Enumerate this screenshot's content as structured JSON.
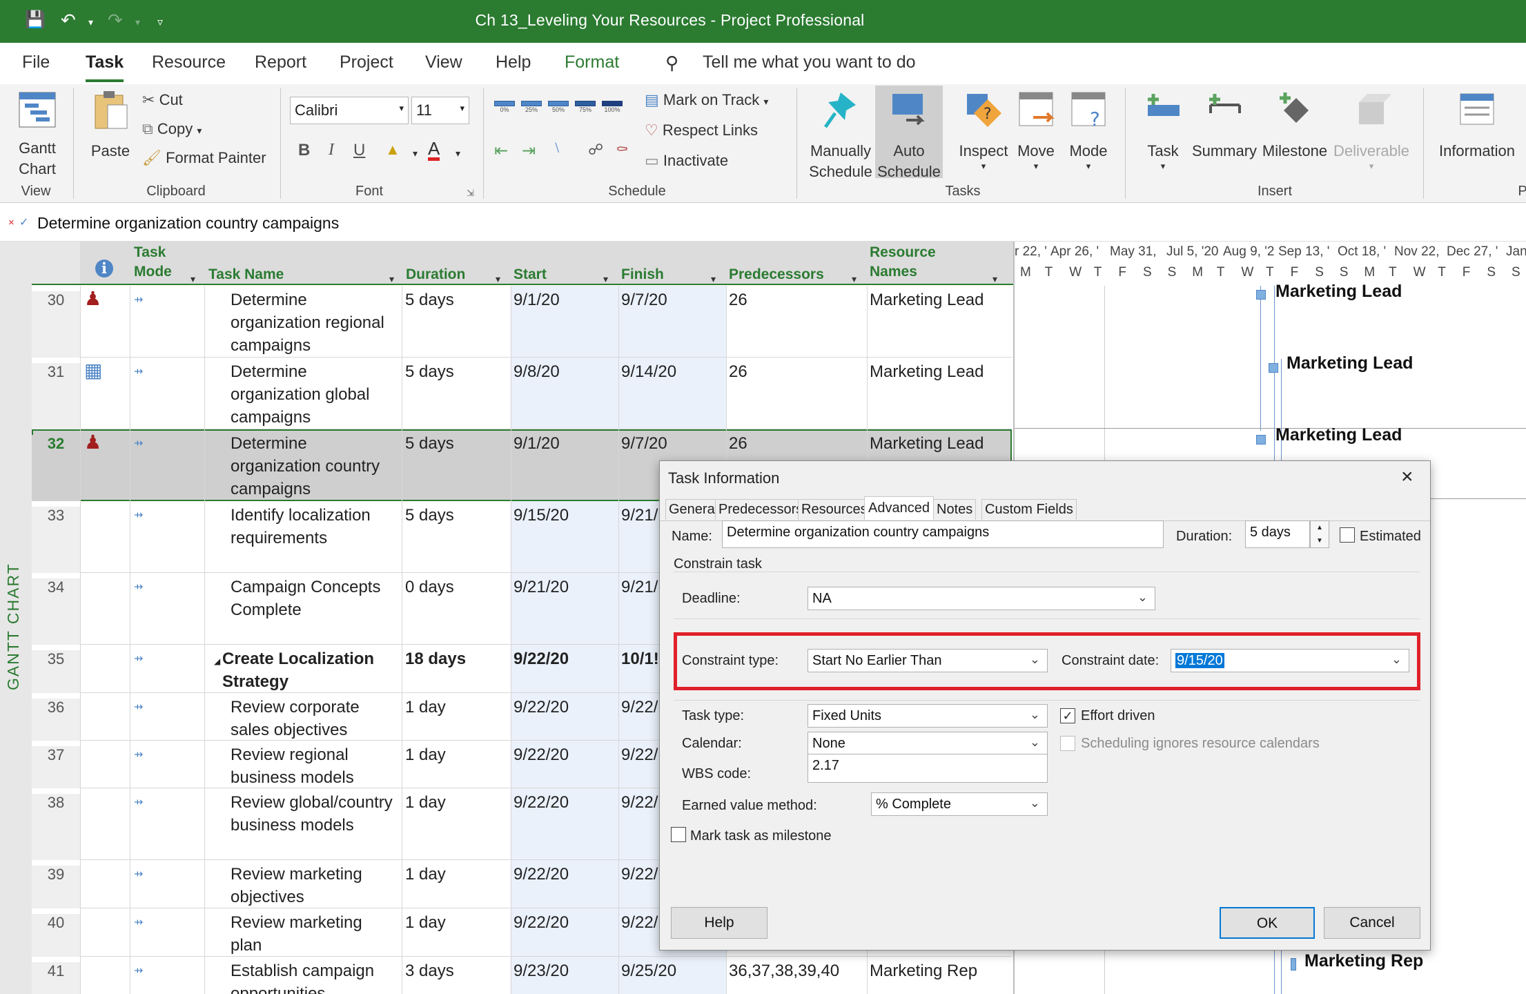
{
  "window": {
    "title": "Ch 13_Leveling Your Resources  -  Project Professional"
  },
  "tabs": [
    "File",
    "Task",
    "Resource",
    "Report",
    "Project",
    "View",
    "Help",
    "Format"
  ],
  "search": {
    "placeholder": "Tell me what you want to do"
  },
  "ribbon": {
    "view_group": {
      "gantt_label": "Gantt\nChart",
      "label": "View"
    },
    "clipboard": {
      "paste": "Paste",
      "cut": "Cut",
      "copy": "Copy",
      "format_painter": "Format Painter",
      "label": "Clipboard"
    },
    "font": {
      "family": "Calibri",
      "size": "11",
      "label": "Font"
    },
    "schedule": {
      "mark_on_track": "Mark on Track",
      "respect_links": "Respect Links",
      "inactivate": "Inactivate",
      "label": "Schedule",
      "pct": [
        "0%",
        "25%",
        "50%",
        "75%",
        "100%"
      ]
    },
    "tasks": {
      "manually": "Manually\nSchedule",
      "auto": "Auto\nSchedule",
      "inspect": "Inspect",
      "move": "Move",
      "mode": "Mode",
      "label": "Tasks"
    },
    "insert": {
      "task": "Task",
      "summary": "Summary",
      "milestone": "Milestone",
      "deliverable": "Deliverable",
      "label": "Insert"
    },
    "properties": {
      "information": "Information",
      "label": "P"
    }
  },
  "entry_bar": {
    "value": "Determine organization country campaigns"
  },
  "side_label": "GANTT CHART",
  "columns": {
    "task_mode": "Task\nMode",
    "task_name": "Task Name",
    "duration": "Duration",
    "start": "Start",
    "finish": "Finish",
    "predecessors": "Predecessors",
    "resource_names": "Resource\nNames"
  },
  "rows": [
    {
      "id": "30",
      "name": "Determine\norganization regional\ncampaigns",
      "duration": "5 days",
      "start": "9/1/20",
      "finish": "9/7/20",
      "pred": "26",
      "res": "Marketing Lead"
    },
    {
      "id": "31",
      "name": "Determine\norganization global\ncampaigns",
      "duration": "5 days",
      "start": "9/8/20",
      "finish": "9/14/20",
      "pred": "26",
      "res": "Marketing Lead"
    },
    {
      "id": "32",
      "name": "Determine\norganization country\ncampaigns",
      "duration": "5 days",
      "start": "9/1/20",
      "finish": "9/7/20",
      "pred": "26",
      "res": "Marketing Lead"
    },
    {
      "id": "33",
      "name": "Identify localization\nrequirements",
      "duration": "5 days",
      "start": "9/15/20",
      "finish": "9/21/",
      "pred": "",
      "res": ""
    },
    {
      "id": "34",
      "name": "Campaign Concepts\nComplete",
      "duration": "0 days",
      "start": "9/21/20",
      "finish": "9/21/",
      "pred": "",
      "res": ""
    },
    {
      "id": "35",
      "name": "Create Localization\nStrategy",
      "duration": "18 days",
      "start": "9/22/20",
      "finish": "10/1!",
      "pred": "",
      "res": ""
    },
    {
      "id": "36",
      "name": "Review corporate\nsales objectives",
      "duration": "1 day",
      "start": "9/22/20",
      "finish": "9/22/",
      "pred": "",
      "res": ""
    },
    {
      "id": "37",
      "name": "Review regional\nbusiness models",
      "duration": "1 day",
      "start": "9/22/20",
      "finish": "9/22/",
      "pred": "",
      "res": ""
    },
    {
      "id": "38",
      "name": "Review global/country\nbusiness models",
      "duration": "1 day",
      "start": "9/22/20",
      "finish": "9/22/",
      "pred": "",
      "res": ""
    },
    {
      "id": "39",
      "name": "Review marketing\nobjectives",
      "duration": "1 day",
      "start": "9/22/20",
      "finish": "9/22/",
      "pred": "",
      "res": ""
    },
    {
      "id": "40",
      "name": "Review marketing\nplan",
      "duration": "1 day",
      "start": "9/22/20",
      "finish": "9/22/",
      "pred": "",
      "res": ""
    },
    {
      "id": "41",
      "name": "Establish campaign\nopportunities",
      "duration": "3 days",
      "start": "9/23/20",
      "finish": "9/25/20",
      "pred": "36,37,38,39,40",
      "res": "Marketing Rep"
    }
  ],
  "timescale": {
    "top": [
      "r 22, '",
      "Apr 26, '",
      "May 31,",
      "Jul 5, '20",
      "Aug 9, '2",
      "Sep 13, '",
      "Oct 18, '",
      "Nov 22,",
      "Dec 27, '",
      "Jan"
    ],
    "days": [
      "M",
      "T",
      "W",
      "T",
      "F",
      "S",
      "S",
      "M",
      "T",
      "W",
      "T",
      "F",
      "S",
      "S",
      "M",
      "T",
      "W",
      "T",
      "F",
      "S",
      "S",
      "M"
    ]
  },
  "gantt_labels": {
    "r30": "Marketing Lead",
    "r31": "Marketing Lead",
    "r32": "Marketing Lead",
    "r41": "Marketing Rep"
  },
  "dialog": {
    "title": "Task Information",
    "tabs": [
      "General",
      "Predecessors",
      "Resources",
      "Advanced",
      "Notes",
      "Custom Fields"
    ],
    "active_tab": "Advanced",
    "name_label": "Name:",
    "name_value": "Determine organization country campaigns",
    "duration_label": "Duration:",
    "duration_value": "5 days",
    "estimated_label": "Estimated",
    "constrain_task": "Constrain task",
    "deadline_label": "Deadline:",
    "deadline_value": "NA",
    "constraint_type_label": "Constraint type:",
    "constraint_type_value": "Start No Earlier Than",
    "constraint_date_label": "Constraint date:",
    "constraint_date_value": "9/15/20",
    "task_type_label": "Task type:",
    "task_type_value": "Fixed Units",
    "effort_driven_label": "Effort driven",
    "calendar_label": "Calendar:",
    "calendar_value": "None",
    "sched_ignores_label": "Scheduling ignores resource calendars",
    "wbs_label": "WBS code:",
    "wbs_value": "2.17",
    "earned_label": "Earned value method:",
    "earned_value": "% Complete",
    "milestone_label": "Mark task as milestone",
    "help": "Help",
    "ok": "OK",
    "cancel": "Cancel",
    "highlight_color": "#e0202a"
  }
}
